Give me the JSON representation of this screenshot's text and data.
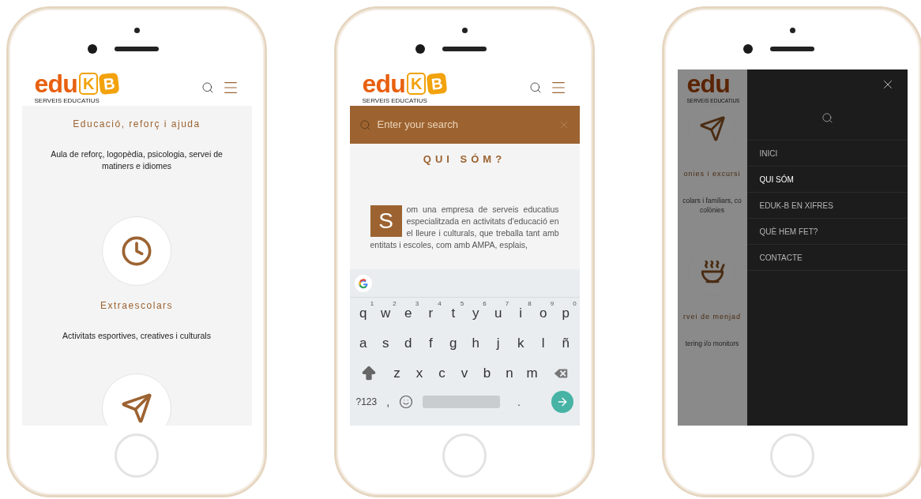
{
  "phones": [
    {
      "kind": "services",
      "logo": {
        "text": "edu",
        "k": "K",
        "b": "B",
        "tagline": "SERVEIS EDUCATIUS"
      },
      "sections": [
        {
          "title": "Educació, reforç i ajuda",
          "text": "Aula de reforç, logopèdia, psicologia, servei de matiners e idiomes"
        },
        {
          "title": "Extraescolars",
          "text": "Activitats esportives, creatives i culturals"
        }
      ]
    },
    {
      "kind": "search",
      "logo": {
        "text": "edu",
        "k": "K",
        "b": "B",
        "tagline": "SERVEIS EDUCATIUS"
      },
      "search": {
        "placeholder": "Enter your search"
      },
      "heading": "QUI SÓM?",
      "drop_cap": "S",
      "body": "om una empresa de serveis educatius especialitzada en activitats d'educació en el lleure i culturals, que treballa tant amb entitats i escoles, com amb AMPA, esplais,",
      "keyboard": {
        "rows": [
          [
            {
              "label": "q",
              "hint": "1"
            },
            {
              "label": "w",
              "hint": "2"
            },
            {
              "label": "e",
              "hint": "3"
            },
            {
              "label": "r",
              "hint": "4"
            },
            {
              "label": "t",
              "hint": "5"
            },
            {
              "label": "y",
              "hint": "6"
            },
            {
              "label": "u",
              "hint": "7"
            },
            {
              "label": "i",
              "hint": "8"
            },
            {
              "label": "o",
              "hint": "9"
            },
            {
              "label": "p",
              "hint": "0"
            }
          ],
          [
            {
              "label": "a"
            },
            {
              "label": "s"
            },
            {
              "label": "d"
            },
            {
              "label": "f"
            },
            {
              "label": "g"
            },
            {
              "label": "h"
            },
            {
              "label": "j"
            },
            {
              "label": "k"
            },
            {
              "label": "l"
            },
            {
              "label": "ñ"
            }
          ],
          [
            {
              "label": "z"
            },
            {
              "label": "x"
            },
            {
              "label": "c"
            },
            {
              "label": "v"
            },
            {
              "label": "b"
            },
            {
              "label": "n"
            },
            {
              "label": "m"
            }
          ]
        ],
        "symbols": "?123",
        "comma": ",",
        "period": "."
      }
    },
    {
      "kind": "menu",
      "logo": {
        "text": "edu",
        "tagline": "SERVEIS EDUCATIUS"
      },
      "background": {
        "section_title": "onies i excursi",
        "text_lines": [
          "colars i familiars, co",
          "colònies"
        ],
        "section_title_2": "rvei de menjad",
        "text_2": "tering i/o monitors"
      },
      "menu": [
        {
          "label": "INICI",
          "selected": false
        },
        {
          "label": "QUI SÓM",
          "selected": true
        },
        {
          "label": "EDUK-B EN XIFRES",
          "selected": false
        },
        {
          "label": "QUÈ HEM FET?",
          "selected": false
        },
        {
          "label": "CONTACTE",
          "selected": false
        }
      ]
    }
  ]
}
